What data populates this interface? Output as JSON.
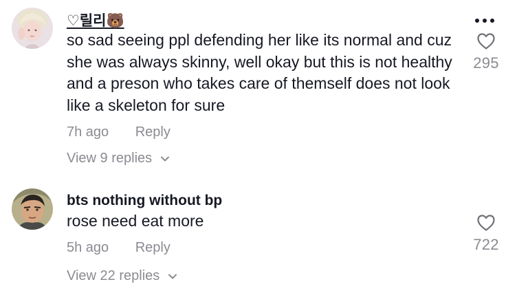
{
  "comments": [
    {
      "username": "♡릴리🐻",
      "text": "so sad seeing ppl defending her like its normal and cuz she was always skinny, well okay but this is not healthy and a preson who takes care of themself does not look like a skeleton for sure",
      "time": "7h ago",
      "reply_label": "Reply",
      "view_replies": "View 9 replies",
      "likes": "295"
    },
    {
      "username": "bts nothing without bp",
      "text": "rose need eat more",
      "time": "5h ago",
      "reply_label": "Reply",
      "view_replies": "View 22 replies",
      "likes": "722"
    }
  ],
  "icons": {
    "more": "more-horizontal-icon",
    "like": "heart-outline-icon",
    "expand": "chevron-down-icon"
  },
  "colors": {
    "text_primary": "#161823",
    "text_secondary": "#8a8b91",
    "background": "#ffffff"
  }
}
